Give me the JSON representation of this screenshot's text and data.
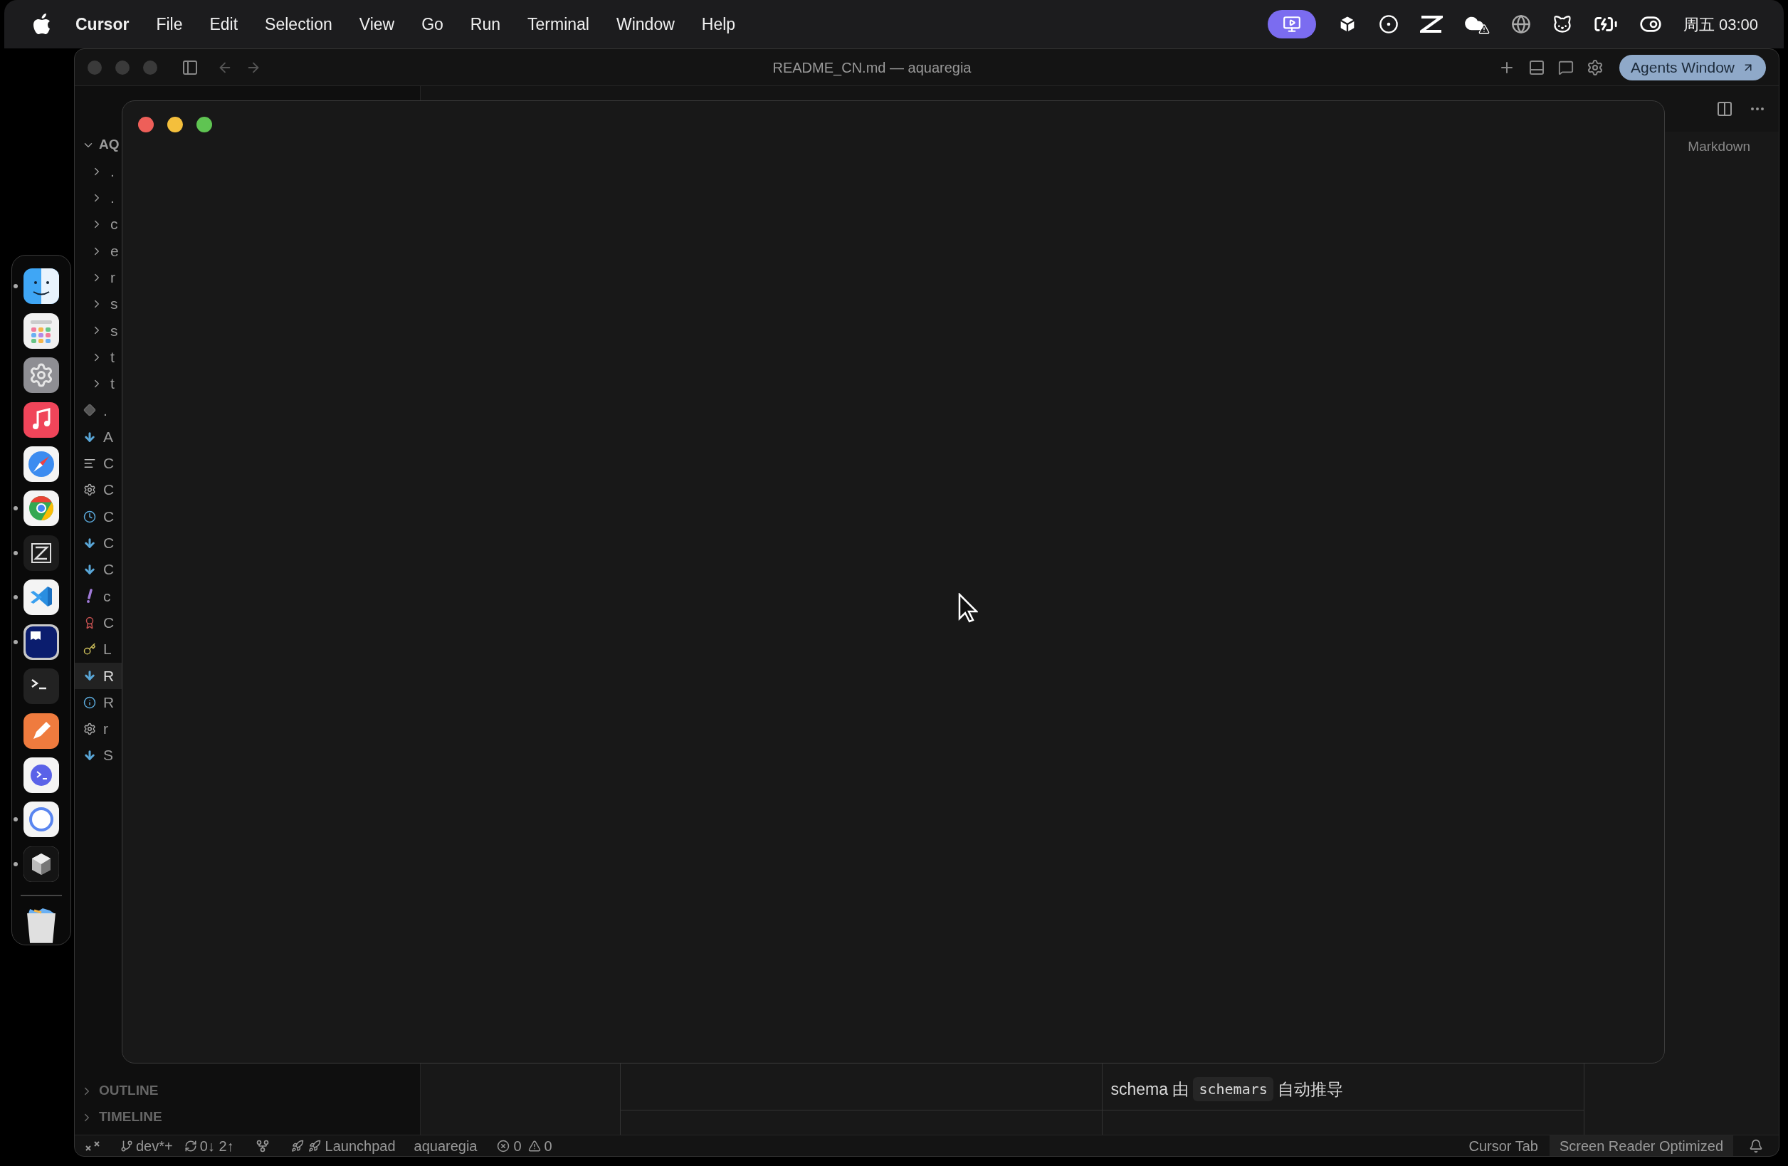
{
  "menu_bar": {
    "app": "Cursor",
    "menus": [
      "File",
      "Edit",
      "Selection",
      "View",
      "Go",
      "Run",
      "Terminal",
      "Window",
      "Help"
    ],
    "clock": "周五 03:00"
  },
  "dock": {
    "apps": [
      {
        "running": true
      },
      {
        "running": false
      },
      {
        "running": false
      },
      {
        "running": false
      },
      {
        "running": false
      },
      {
        "running": true
      },
      {
        "running": true
      },
      {
        "running": true
      },
      {
        "running": true
      },
      {
        "running": false
      },
      {
        "running": false
      },
      {
        "running": false
      },
      {
        "running": true
      },
      {
        "running": true
      }
    ]
  },
  "window": {
    "title": "README_CN.md — aquaregia",
    "agents_button": "Agents Window"
  },
  "explorer": {
    "header": "AQ",
    "expanded": true,
    "items": [
      {
        "label": ".",
        "kind": "folder",
        "selected": false
      },
      {
        "label": ".",
        "kind": "folder",
        "selected": false
      },
      {
        "label": "c",
        "kind": "folder",
        "selected": false
      },
      {
        "label": "e",
        "kind": "folder",
        "selected": false
      },
      {
        "label": "r",
        "kind": "folder",
        "selected": false
      },
      {
        "label": "s",
        "kind": "folder",
        "selected": false
      },
      {
        "label": "s",
        "kind": "folder",
        "selected": false
      },
      {
        "label": "t",
        "kind": "folder",
        "selected": false
      },
      {
        "label": "t",
        "kind": "folder",
        "selected": false
      },
      {
        "label": ".",
        "kind": "git",
        "selected": false
      },
      {
        "label": "A",
        "kind": "markdown",
        "selected": false
      },
      {
        "label": "C",
        "kind": "text",
        "selected": false
      },
      {
        "label": "C",
        "kind": "config",
        "selected": false
      },
      {
        "label": "C",
        "kind": "history",
        "selected": false
      },
      {
        "label": "C",
        "kind": "markdown",
        "selected": false
      },
      {
        "label": "C",
        "kind": "markdown",
        "selected": false
      },
      {
        "label": "c",
        "kind": "yaml",
        "selected": false
      },
      {
        "label": "C",
        "kind": "badge",
        "selected": false
      },
      {
        "label": "L",
        "kind": "key",
        "selected": false
      },
      {
        "label": "R",
        "kind": "markdown",
        "selected": true
      },
      {
        "label": "R",
        "kind": "info",
        "selected": false
      },
      {
        "label": "r",
        "kind": "config",
        "selected": false
      },
      {
        "label": "S",
        "kind": "markdown",
        "selected": false
      }
    ]
  },
  "outline": {
    "label": "OUTLINE",
    "expanded": false
  },
  "timeline": {
    "label": "TIMELINE",
    "expanded": false
  },
  "editor": {
    "language": "Markdown",
    "table_cell": [
      {
        "text": "schema 由 ",
        "code": false
      },
      {
        "text": "schemars",
        "code": true
      },
      {
        "text": " 自动推导",
        "code": false
      }
    ]
  },
  "status_bar": {
    "branch": "dev*+",
    "sync": "0↓ 2↑",
    "launchpad": "Launchpad",
    "project": "aquaregia",
    "errors": "0",
    "warnings": "0",
    "cursor_tab": "Cursor Tab",
    "screen_reader": "Screen Reader Optimized"
  }
}
